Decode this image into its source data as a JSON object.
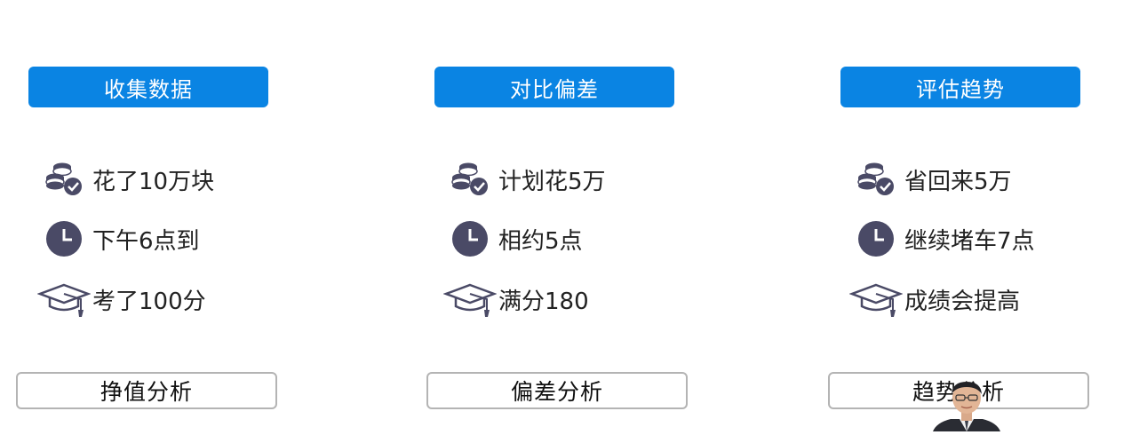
{
  "columns": [
    {
      "header": "收集数据",
      "items": [
        {
          "icon": "coins-check-icon",
          "text": "花了10万块"
        },
        {
          "icon": "clock-icon",
          "text": "下午6点到"
        },
        {
          "icon": "graduation-cap-icon",
          "text": "考了100分"
        }
      ],
      "footer": "挣值分析"
    },
    {
      "header": "对比偏差",
      "items": [
        {
          "icon": "coins-check-icon",
          "text": "计划花5万"
        },
        {
          "icon": "clock-icon",
          "text": "相约5点"
        },
        {
          "icon": "graduation-cap-icon",
          "text": "满分180"
        }
      ],
      "footer": "偏差分析"
    },
    {
      "header": "评估趋势",
      "items": [
        {
          "icon": "coins-check-icon",
          "text": "省回来5万"
        },
        {
          "icon": "clock-icon",
          "text": "继续堵车7点"
        },
        {
          "icon": "graduation-cap-icon",
          "text": "成绩会提高"
        }
      ],
      "footer": "趋势分析"
    }
  ],
  "colors": {
    "header_bg": "#0a84e3",
    "icon": "#4a4a66",
    "footer_border": "#b4b4b4"
  }
}
